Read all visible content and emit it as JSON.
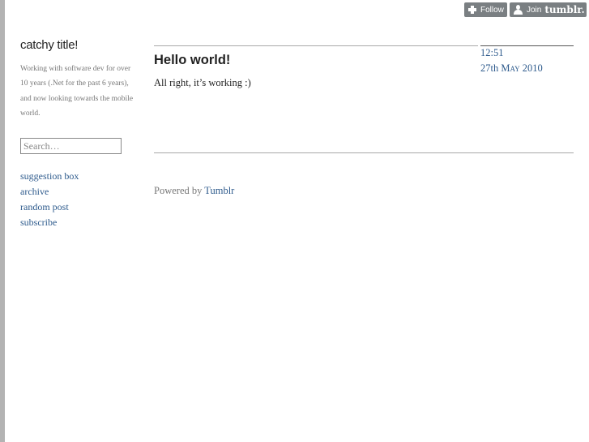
{
  "tumblr_controls": {
    "follow_label": "Follow",
    "join_label": "Join",
    "brand": "tumblr."
  },
  "sidebar": {
    "title": "catchy title!",
    "description": "Working with software dev for over 10 years (.Net for the past 6 years), and now looking towards the mobile world.",
    "search_placeholder": "Search…",
    "links": [
      "suggestion box",
      "archive",
      "random post",
      "subscribe"
    ]
  },
  "post": {
    "title": "Hello world!",
    "body": "All right, it’s working :)",
    "time": "12:51",
    "date_day": "27th",
    "date_month_year": "May 2010"
  },
  "footer": {
    "prefix": "Powered by",
    "link": "Tumblr"
  },
  "colors": {
    "link": "#2d5a8c",
    "button_bg": "#7a7f82"
  }
}
